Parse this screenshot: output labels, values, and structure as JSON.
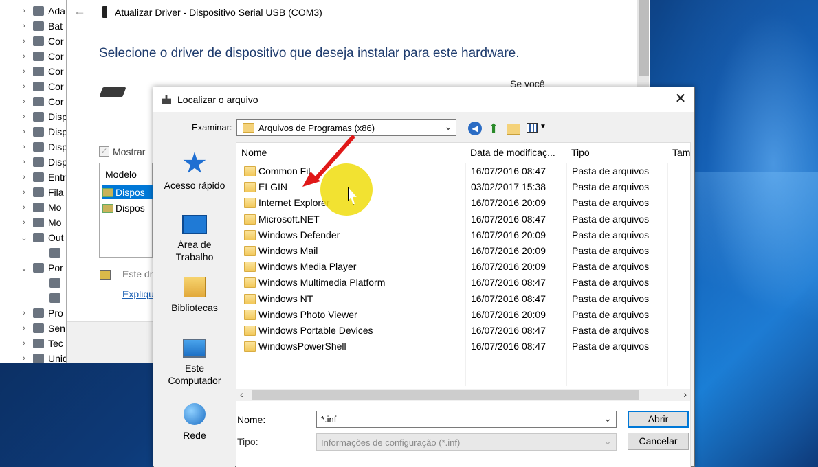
{
  "device_manager": {
    "items": [
      "Ada",
      "Bat",
      "Cor",
      "Cor",
      "Cor",
      "Cor",
      "Cor",
      "Disp",
      "Disp",
      "Disp",
      "Disp",
      "Entr",
      "Fila",
      "Mo",
      "Mo",
      "Out",
      "",
      "Por",
      "",
      "",
      "Pro",
      "Sen",
      "Tec",
      "Unidades de disco"
    ]
  },
  "wizard": {
    "title": "Atualizar Driver - Dispositivo Serial USB (COM3)",
    "heading": "Selecione o driver de dispositivo que deseja instalar para este hardware.",
    "partial_text": "Se você",
    "checkbox_label": "Mostrar",
    "model_header": "Modelo",
    "model_rows": [
      "Dispos",
      "Dispos"
    ],
    "note_text": "Este dri",
    "link_text": "Expliqu"
  },
  "dialog": {
    "title": "Localizar o arquivo",
    "examinar_label": "Examinar:",
    "examinar_value": "Arquivos de Programas (x86)",
    "places": [
      {
        "icon": "quick-access-icon",
        "label": "Acesso rápido"
      },
      {
        "icon": "desktop-icon",
        "label": "Área de Trabalho"
      },
      {
        "icon": "libraries-icon",
        "label": "Bibliotecas"
      },
      {
        "icon": "computer-icon",
        "label": "Este Computador"
      },
      {
        "icon": "network-icon",
        "label": "Rede"
      }
    ],
    "columns": {
      "name": "Nome",
      "date": "Data de modificaç...",
      "type": "Tipo",
      "size": "Tam"
    },
    "files": [
      {
        "name": "Common Fil",
        "date": "16/07/2016 08:47",
        "type": "Pasta de arquivos"
      },
      {
        "name": "ELGIN",
        "date": "03/02/2017 15:38",
        "type": "Pasta de arquivos"
      },
      {
        "name": "Internet Explorer",
        "date": "16/07/2016 20:09",
        "type": "Pasta de arquivos"
      },
      {
        "name": "Microsoft.NET",
        "date": "16/07/2016 08:47",
        "type": "Pasta de arquivos"
      },
      {
        "name": "Windows Defender",
        "date": "16/07/2016 20:09",
        "type": "Pasta de arquivos"
      },
      {
        "name": "Windows Mail",
        "date": "16/07/2016 20:09",
        "type": "Pasta de arquivos"
      },
      {
        "name": "Windows Media Player",
        "date": "16/07/2016 20:09",
        "type": "Pasta de arquivos"
      },
      {
        "name": "Windows Multimedia Platform",
        "date": "16/07/2016 08:47",
        "type": "Pasta de arquivos"
      },
      {
        "name": "Windows NT",
        "date": "16/07/2016 08:47",
        "type": "Pasta de arquivos"
      },
      {
        "name": "Windows Photo Viewer",
        "date": "16/07/2016 20:09",
        "type": "Pasta de arquivos"
      },
      {
        "name": "Windows Portable Devices",
        "date": "16/07/2016 08:47",
        "type": "Pasta de arquivos"
      },
      {
        "name": "WindowsPowerShell",
        "date": "16/07/2016 08:47",
        "type": "Pasta de arquivos"
      }
    ],
    "name_label": "Nome:",
    "name_value": "*.inf",
    "type_label": "Tipo:",
    "type_value": "Informações de configuração (*.inf)",
    "open_button": "Abrir",
    "cancel_button": "Cancelar"
  },
  "colors": {
    "accent": "#0078d7",
    "heading": "#1f3c6e",
    "highlight": "#f0de14",
    "arrow": "#e01818"
  }
}
